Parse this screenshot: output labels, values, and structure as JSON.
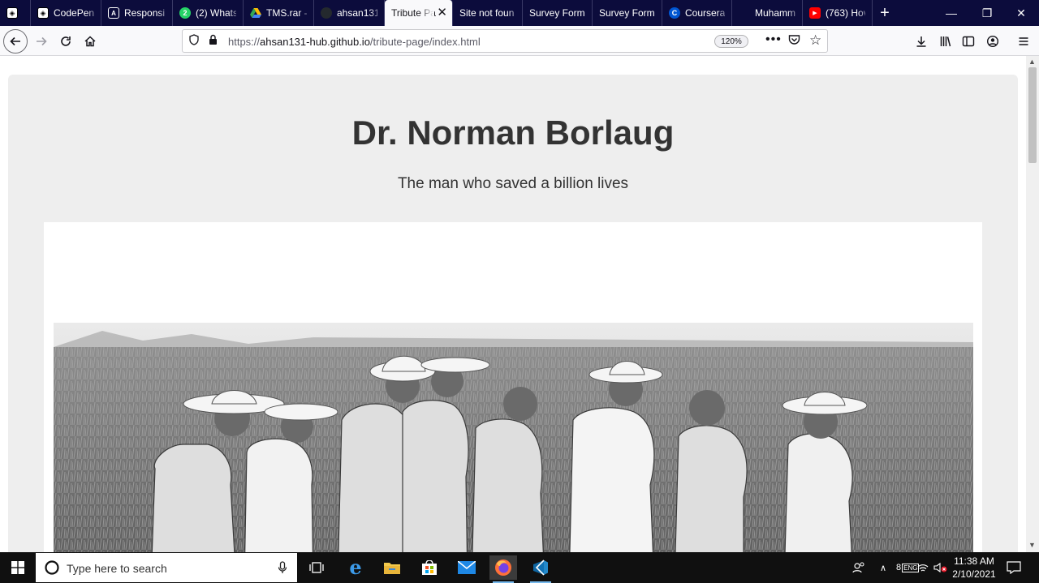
{
  "browser": {
    "tabs": [
      {
        "label": "",
        "favicon": "codepen-icon",
        "color": "#ffffff"
      },
      {
        "label": "CodePen",
        "favicon": "codepen-icon",
        "color": "#ffffff"
      },
      {
        "label": "Responsi",
        "favicon": "a-badge-icon",
        "color": "#ffffff"
      },
      {
        "label": "(2) Whats",
        "favicon": "whatsapp-icon",
        "color": "#25d366"
      },
      {
        "label": "TMS.rar -",
        "favicon": "google-drive-icon",
        "color": "#fbbc04"
      },
      {
        "label": "ahsan131",
        "favicon": "github-icon",
        "color": "#24292e"
      },
      {
        "label": "Tribute Pa",
        "favicon": "none",
        "color": "#ffffff",
        "active": true
      },
      {
        "label": "Site not foun",
        "favicon": "none",
        "color": "#ffffff"
      },
      {
        "label": "Survey Form",
        "favicon": "none",
        "color": "#ffffff"
      },
      {
        "label": "Survey Form",
        "favicon": "none",
        "color": "#ffffff"
      },
      {
        "label": "Coursera",
        "favicon": "coursera-icon",
        "color": "#0056d2"
      },
      {
        "label": "Muhamm",
        "favicon": "none",
        "color": "#ffffff"
      },
      {
        "label": "(763) Hov",
        "favicon": "youtube-icon",
        "color": "#ff0000"
      }
    ],
    "url_prefix": "https://",
    "url_host": "ahsan131-hub.github.io",
    "url_path": "/tribute-page/index.html",
    "zoom": "120%"
  },
  "page": {
    "title": "Dr. Norman Borlaug",
    "subtitle": "The man who saved a billion lives",
    "image_label": "Norman Borlaug with team in a wheat field"
  },
  "taskbar": {
    "search_placeholder": "Type here to search",
    "time": "11:38 AM",
    "date": "2/10/2021",
    "tray_badge": "8",
    "input_lang": "ENG"
  },
  "colors": {
    "tabbar_bg": "#0c0c3c",
    "page_panel": "#eeeeee",
    "text": "#333333",
    "taskbar_bg": "#101010"
  }
}
